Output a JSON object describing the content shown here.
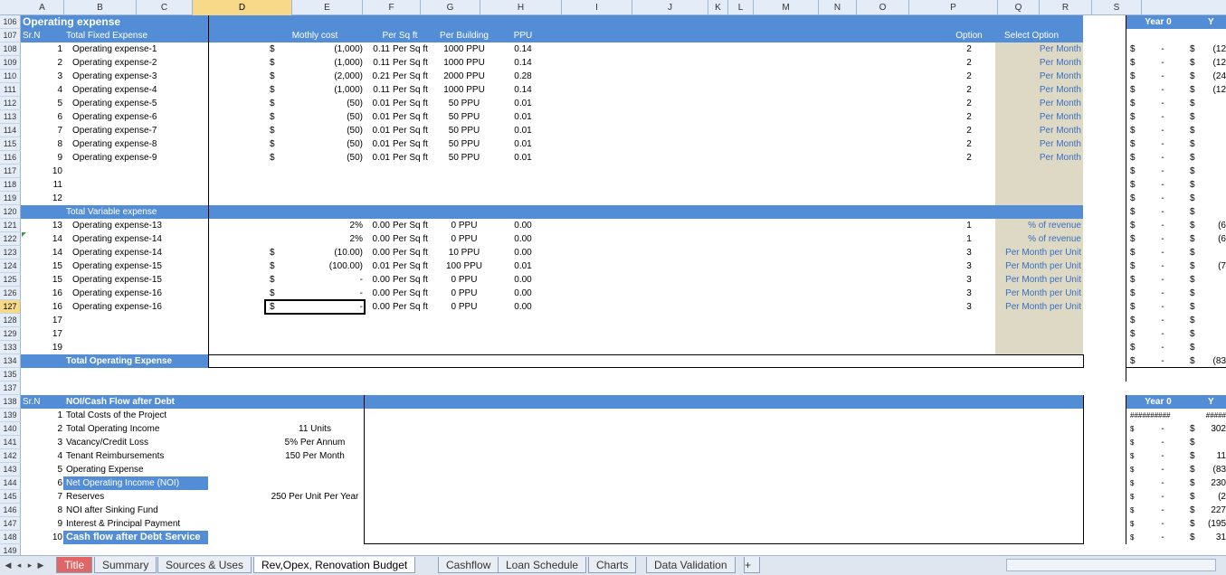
{
  "columns": [
    "A",
    "B",
    "C",
    "D",
    "E",
    "F",
    "G",
    "H",
    "I",
    "J",
    "K",
    "L",
    "M",
    "N",
    "O",
    "P",
    "Q",
    "R",
    "S"
  ],
  "row_numbers": [
    "106",
    "107",
    "108",
    "109",
    "110",
    "111",
    "112",
    "113",
    "114",
    "115",
    "116",
    "117",
    "118",
    "119",
    "120",
    "121",
    "122",
    "123",
    "124",
    "125",
    "126",
    "127",
    "128",
    "129",
    "133",
    "134",
    "135",
    "137",
    "138",
    "139",
    "140",
    "141",
    "142",
    "143",
    "144",
    "145",
    "146",
    "147",
    "148",
    "149"
  ],
  "section1": {
    "title": "Operating expense",
    "srn_label": "Sr.N",
    "fixed_label": "Total Fixed Expense",
    "headers": {
      "monthly": "Mothly cost",
      "persqft": "Per Sq ft",
      "perbuilding": "Per Building",
      "ppu": "PPU",
      "option": "Option",
      "select": "Select Option"
    },
    "fixed_rows": [
      {
        "n": "1",
        "name": "Operating expense-1",
        "cur": "$",
        "cost": "(1,000)",
        "sq": "0.11",
        "unit": "Per Sq ft",
        "bld": "1000 PPU",
        "ppu": "0.14",
        "opt": "2",
        "sel": "Per Month"
      },
      {
        "n": "2",
        "name": "Operating expense-2",
        "cur": "$",
        "cost": "(1,000)",
        "sq": "0.11",
        "unit": "Per Sq ft",
        "bld": "1000 PPU",
        "ppu": "0.14",
        "opt": "2",
        "sel": "Per Month"
      },
      {
        "n": "3",
        "name": "Operating expense-3",
        "cur": "$",
        "cost": "(2,000)",
        "sq": "0.21",
        "unit": "Per Sq ft",
        "bld": "2000 PPU",
        "ppu": "0.28",
        "opt": "2",
        "sel": "Per Month"
      },
      {
        "n": "4",
        "name": "Operating expense-4",
        "cur": "$",
        "cost": "(1,000)",
        "sq": "0.11",
        "unit": "Per Sq ft",
        "bld": "1000 PPU",
        "ppu": "0.14",
        "opt": "2",
        "sel": "Per Month"
      },
      {
        "n": "5",
        "name": "Operating expense-5",
        "cur": "$",
        "cost": "(50)",
        "sq": "0.01",
        "unit": "Per Sq ft",
        "bld": "50 PPU",
        "ppu": "0.01",
        "opt": "2",
        "sel": "Per Month"
      },
      {
        "n": "6",
        "name": "Operating expense-6",
        "cur": "$",
        "cost": "(50)",
        "sq": "0.01",
        "unit": "Per Sq ft",
        "bld": "50 PPU",
        "ppu": "0.01",
        "opt": "2",
        "sel": "Per Month"
      },
      {
        "n": "7",
        "name": "Operating expense-7",
        "cur": "$",
        "cost": "(50)",
        "sq": "0.01",
        "unit": "Per Sq ft",
        "bld": "50 PPU",
        "ppu": "0.01",
        "opt": "2",
        "sel": "Per Month"
      },
      {
        "n": "8",
        "name": "Operating expense-8",
        "cur": "$",
        "cost": "(50)",
        "sq": "0.01",
        "unit": "Per Sq ft",
        "bld": "50 PPU",
        "ppu": "0.01",
        "opt": "2",
        "sel": "Per Month"
      },
      {
        "n": "9",
        "name": "Operating expense-9",
        "cur": "$",
        "cost": "(50)",
        "sq": "0.01",
        "unit": "Per Sq ft",
        "bld": "50 PPU",
        "ppu": "0.01",
        "opt": "2",
        "sel": "Per Month"
      },
      {
        "n": "10",
        "name": "",
        "cur": "",
        "cost": "",
        "sq": "",
        "unit": "",
        "bld": "",
        "ppu": "",
        "opt": "",
        "sel": ""
      },
      {
        "n": "11",
        "name": "",
        "cur": "",
        "cost": "",
        "sq": "",
        "unit": "",
        "bld": "",
        "ppu": "",
        "opt": "",
        "sel": ""
      },
      {
        "n": "12",
        "name": "",
        "cur": "",
        "cost": "",
        "sq": "",
        "unit": "",
        "bld": "",
        "ppu": "",
        "opt": "",
        "sel": ""
      }
    ],
    "variable_label": "Total Variable expense",
    "variable_rows": [
      {
        "n": "13",
        "name": "Operating expense-13",
        "cur": "",
        "cost": "2%",
        "sq": "0.00",
        "unit": "Per Sq ft",
        "bld": "0 PPU",
        "ppu": "0.00",
        "opt": "1",
        "sel": "% of revenue"
      },
      {
        "n": "14",
        "name": "Operating expense-14",
        "cur": "",
        "cost": "2%",
        "sq": "0.00",
        "unit": "Per Sq ft",
        "bld": "0 PPU",
        "ppu": "0.00",
        "opt": "1",
        "sel": "% of revenue"
      },
      {
        "n": "14",
        "name": "Operating expense-14",
        "cur": "$",
        "cost": "(10.00)",
        "sq": "0.00",
        "unit": "Per Sq ft",
        "bld": "10 PPU",
        "ppu": "0.00",
        "opt": "3",
        "sel": "Per Month per Unit"
      },
      {
        "n": "15",
        "name": "Operating expense-15",
        "cur": "$",
        "cost": "(100.00)",
        "sq": "0.01",
        "unit": "Per Sq ft",
        "bld": "100 PPU",
        "ppu": "0.01",
        "opt": "3",
        "sel": "Per Month per Unit"
      },
      {
        "n": "15",
        "name": "Operating expense-15",
        "cur": "$",
        "cost": "-",
        "sq": "0.00",
        "unit": "Per Sq ft",
        "bld": "0 PPU",
        "ppu": "0.00",
        "opt": "3",
        "sel": "Per Month per Unit"
      },
      {
        "n": "16",
        "name": "Operating expense-16",
        "cur": "$",
        "cost": "-",
        "sq": "0.00",
        "unit": "Per Sq ft",
        "bld": "0 PPU",
        "ppu": "0.00",
        "opt": "3",
        "sel": "Per Month per Unit"
      },
      {
        "n": "16",
        "name": "Operating expense-16",
        "cur": "$",
        "cost": "-",
        "sq": "0.00",
        "unit": "Per Sq ft",
        "bld": "0 PPU",
        "ppu": "0.00",
        "opt": "3",
        "sel": "Per Month per Unit"
      },
      {
        "n": "17",
        "name": "",
        "cur": "",
        "cost": "",
        "sq": "",
        "unit": "",
        "bld": "",
        "ppu": "",
        "opt": "",
        "sel": ""
      },
      {
        "n": "17",
        "name": "",
        "cur": "",
        "cost": "",
        "sq": "",
        "unit": "",
        "bld": "",
        "ppu": "",
        "opt": "",
        "sel": ""
      },
      {
        "n": "19",
        "name": "",
        "cur": "",
        "cost": "",
        "sq": "",
        "unit": "",
        "bld": "",
        "ppu": "",
        "opt": "",
        "sel": ""
      }
    ],
    "total_label": "Total Operating Expense"
  },
  "right_panel": {
    "year0": "Year 0",
    "year1_fragment": "Y",
    "cols": [
      {
        "a": "$",
        "b": "-",
        "c": "$",
        "d": "(12"
      },
      {
        "a": "$",
        "b": "-",
        "c": "$",
        "d": "(12"
      },
      {
        "a": "$",
        "b": "-",
        "c": "$",
        "d": "(24"
      },
      {
        "a": "$",
        "b": "-",
        "c": "$",
        "d": "(12"
      },
      {
        "a": "$",
        "b": "-",
        "c": "$",
        "d": ""
      },
      {
        "a": "$",
        "b": "-",
        "c": "$",
        "d": ""
      },
      {
        "a": "$",
        "b": "-",
        "c": "$",
        "d": ""
      },
      {
        "a": "$",
        "b": "-",
        "c": "$",
        "d": ""
      },
      {
        "a": "$",
        "b": "-",
        "c": "$",
        "d": ""
      },
      {
        "a": "$",
        "b": "-",
        "c": "$",
        "d": ""
      },
      {
        "a": "$",
        "b": "-",
        "c": "$",
        "d": ""
      },
      {
        "a": "$",
        "b": "-",
        "c": "$",
        "d": ""
      },
      {
        "a": "$",
        "b": "-",
        "c": "$",
        "d": ""
      },
      {
        "a": "$",
        "b": "-",
        "c": "$",
        "d": "(6"
      },
      {
        "a": "$",
        "b": "-",
        "c": "$",
        "d": "(6"
      },
      {
        "a": "$",
        "b": "-",
        "c": "$",
        "d": ""
      },
      {
        "a": "$",
        "b": "-",
        "c": "$",
        "d": "(7"
      },
      {
        "a": "$",
        "b": "-",
        "c": "$",
        "d": ""
      },
      {
        "a": "$",
        "b": "-",
        "c": "$",
        "d": ""
      },
      {
        "a": "$",
        "b": "-",
        "c": "$",
        "d": ""
      },
      {
        "a": "$",
        "b": "-",
        "c": "$",
        "d": ""
      },
      {
        "a": "$",
        "b": "-",
        "c": "$",
        "d": ""
      },
      {
        "a": "$",
        "b": "-",
        "c": "$",
        "d": ""
      }
    ],
    "total": {
      "a": "$",
      "b": "-",
      "c": "$",
      "d": "(83"
    },
    "noi_year0": "Year 0",
    "noi_year1_fragment": "Y",
    "noi_rows": [
      {
        "a": "##########",
        "b": "",
        "c": "",
        "d": "#####"
      },
      {
        "a": "$",
        "b": "-",
        "c": "$",
        "d": "302"
      },
      {
        "a": "$",
        "b": "-",
        "c": "$",
        "d": ""
      },
      {
        "a": "$",
        "b": "-",
        "c": "$",
        "d": "11"
      },
      {
        "a": "$",
        "b": "-",
        "c": "$",
        "d": "(83"
      },
      {
        "a": "$",
        "b": "-",
        "c": "$",
        "d": "230"
      },
      {
        "a": "$",
        "b": "-",
        "c": "$",
        "d": "(2"
      },
      {
        "a": "$",
        "b": "-",
        "c": "$",
        "d": "227"
      },
      {
        "a": "$",
        "b": "-",
        "c": "$",
        "d": "(195"
      },
      {
        "a": "$",
        "b": "-",
        "c": "$",
        "d": "31"
      }
    ]
  },
  "section2": {
    "srn_label": "Sr.N",
    "title": "NOI/Cash Flow after Debt",
    "rows": [
      {
        "n": "1",
        "name": "Total Costs of the Project",
        "val": "",
        "hl": false
      },
      {
        "n": "2",
        "name": "Total Operating Income",
        "val": "11 Units",
        "hl": false
      },
      {
        "n": "3",
        "name": "Vacancy/Credit Loss",
        "val": "5% Per Annum",
        "hl": false
      },
      {
        "n": "4",
        "name": "Tenant Reimbursements",
        "val": "150 Per Month",
        "hl": false
      },
      {
        "n": "5",
        "name": "Operating Expense",
        "val": "",
        "hl": false
      },
      {
        "n": "6",
        "name": "Net Operating Income (NOI)",
        "val": "",
        "hl": true
      },
      {
        "n": "7",
        "name": "Reserves",
        "val": "250 Per Unit Per Year",
        "hl": false
      },
      {
        "n": "8",
        "name": "NOI after Sinking Fund",
        "val": "",
        "hl": false
      },
      {
        "n": "9",
        "name": "Interest & Principal Payment",
        "val": "",
        "hl": false
      },
      {
        "n": "10",
        "name": "Cash flow after Debt Service",
        "val": "",
        "hl": true
      }
    ]
  },
  "sheet_tabs": [
    "Title",
    "Summary",
    "Sources & Uses",
    "Rev,Opex, Renovation Budget",
    "Cashflow",
    "Loan Schedule",
    "Charts",
    "Data Validation"
  ],
  "active_tab": "Rev,Opex, Renovation Budget",
  "colors": {
    "header_blue": "#538dd5",
    "beige": "#ddd9c4",
    "option_text": "#3a6fc0",
    "tab_red": "#e06666"
  }
}
